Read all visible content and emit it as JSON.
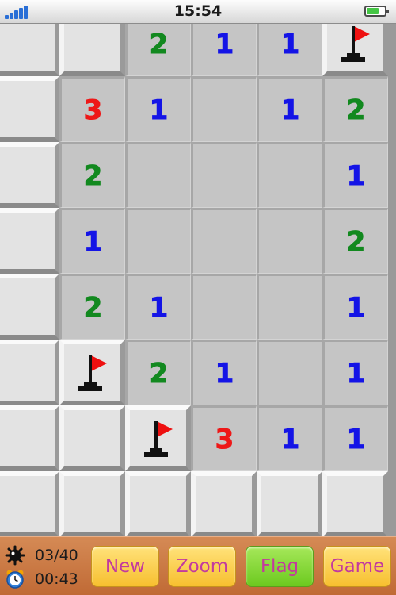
{
  "status_bar": {
    "time": "15:54",
    "signal_bars": 5,
    "battery_level": 0.7
  },
  "board": {
    "visible_columns": 6,
    "visible_rows": 8,
    "cells": [
      [
        "raised",
        "raised",
        "2",
        "1",
        "1",
        "flag"
      ],
      [
        "raised",
        "3",
        "1",
        "open",
        "1",
        "2"
      ],
      [
        "raised",
        "2",
        "open",
        "open",
        "open",
        "1"
      ],
      [
        "raised",
        "1",
        "open",
        "open",
        "open",
        "2"
      ],
      [
        "raised",
        "2",
        "1",
        "open",
        "open",
        "1"
      ],
      [
        "raised",
        "flag",
        "2",
        "1",
        "open",
        "1"
      ],
      [
        "raised",
        "raised",
        "flag",
        "3",
        "1",
        "1"
      ],
      [
        "raised",
        "raised",
        "raised",
        "raised",
        "raised",
        "raised"
      ]
    ],
    "number_colors": {
      "1": "#1414e6",
      "2": "#12891f",
      "3": "#ee1818"
    }
  },
  "toolbar": {
    "mines_counter": "03/40",
    "timer": "00:43",
    "mine_icon": "mine-icon",
    "clock_icon": "alarm-clock-icon",
    "buttons": {
      "new": "New",
      "zoom": "Zoom",
      "flag": "Flag",
      "game": "Game"
    },
    "active_mode": "flag"
  }
}
